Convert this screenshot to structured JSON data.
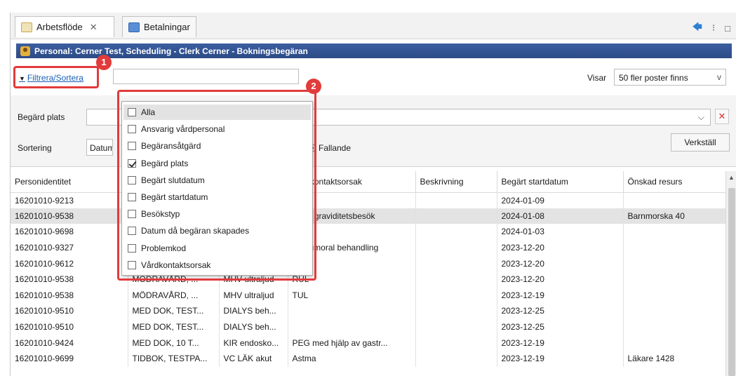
{
  "tabs": [
    {
      "label": "Arbetsflöde",
      "close": "✕",
      "active": true,
      "icon": "document-icon"
    },
    {
      "label": "Betalningar",
      "active": false,
      "icon": "payments-icon"
    }
  ],
  "tab_tools": {
    "back": "🡄",
    "menu": "⁝",
    "restore": "□"
  },
  "title": "Personal: Cerner Test, Scheduling - Clerk Cerner - Bokningsbegäran",
  "filter": {
    "toggle_label": "Filtrera/Sortera",
    "search_value": ""
  },
  "visar": {
    "label": "Visar",
    "value": "50 fler poster finns",
    "chevron": "v"
  },
  "panel": {
    "plats_label": "Begärd plats",
    "clear": "✕",
    "sort_label": "Sortering",
    "sort_value": "Datum",
    "order_label": "Fallande",
    "apply_label": "Verkställ"
  },
  "dropdown": {
    "items": [
      {
        "label": "Alla",
        "checked": false
      },
      {
        "label": "Ansvarig vårdpersonal",
        "checked": false
      },
      {
        "label": "Begäransåtgärd",
        "checked": false
      },
      {
        "label": "Begärd plats",
        "checked": true
      },
      {
        "label": "Begärt slutdatum",
        "checked": false
      },
      {
        "label": "Begärt startdatum",
        "checked": false
      },
      {
        "label": "Besökstyp",
        "checked": false
      },
      {
        "label": "Datum då begäran skapades",
        "checked": false
      },
      {
        "label": "Problemkod",
        "checked": false
      },
      {
        "label": "Vårdkontaktsorsak",
        "checked": false
      }
    ]
  },
  "annotations": {
    "badge1": "1",
    "badge2": "2",
    "color": "#e23b3b"
  },
  "table": {
    "columns": [
      "Personidentitet",
      "",
      "",
      "Vårdkontaktsorsak",
      "Beskrivning",
      "Begärt startdatum",
      "Önskad resurs"
    ],
    "rows": [
      [
        "16201010-9213",
        "",
        "",
        "",
        "",
        "2024-01-09",
        ""
      ],
      [
        "16201010-9538",
        "",
        "",
        "Extra graviditetsbesök",
        "",
        "2024-01-08",
        "Barnmorska 40"
      ],
      [
        "16201010-9698",
        "",
        "",
        "",
        "",
        "2024-01-03",
        ""
      ],
      [
        "16201010-9327",
        "",
        "",
        "Antitumoral behandling",
        "",
        "2023-12-20",
        ""
      ],
      [
        "16201010-9612",
        "",
        "",
        "",
        "",
        "2023-12-20",
        ""
      ],
      [
        "16201010-9538",
        "MÖDRAVÅRD, ...",
        "MHV ultraljud",
        "RUL",
        "",
        "2023-12-20",
        ""
      ],
      [
        "16201010-9538",
        "MÖDRAVÅRD, ...",
        "MHV ultraljud",
        "TUL",
        "",
        "2023-12-19",
        ""
      ],
      [
        "16201010-9510",
        "MED DOK, TEST...",
        "DIALYS beh...",
        "",
        "",
        "2023-12-25",
        ""
      ],
      [
        "16201010-9510",
        "MED DOK, TEST...",
        "DIALYS beh...",
        "",
        "",
        "2023-12-25",
        ""
      ],
      [
        "16201010-9424",
        "MED DOK, 10 T...",
        "KIR endosko...",
        "PEG med hjälp av gastr...",
        "",
        "2023-12-19",
        ""
      ],
      [
        "16201010-9699",
        "TIDBOK, TESTPA...",
        "VC LÄK akut",
        "Astma",
        "",
        "2023-12-19",
        "Läkare 1428"
      ]
    ],
    "selected_row": 1
  }
}
